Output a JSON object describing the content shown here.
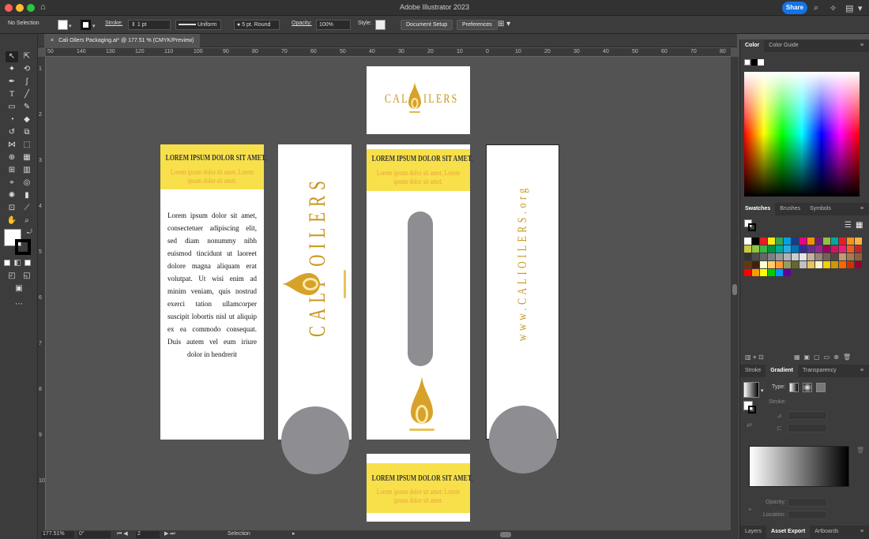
{
  "app": {
    "title": "Adobe Illustrator 2023",
    "share_label": "Share"
  },
  "control_bar": {
    "selection": "No Selection",
    "stroke_label": "Stroke:",
    "stroke_value": "1 pt",
    "profile": "Uniform",
    "brush": "5 pt. Round",
    "opacity_label": "Opacity:",
    "opacity_value": "100%",
    "style_label": "Style:",
    "document_setup": "Document Setup",
    "preferences": "Preferences"
  },
  "document": {
    "tab_title": "Cali Oilers Packaging.ai* @ 177.51 % (CMYK/Preview)"
  },
  "ruler_h": [
    "50",
    "140",
    "130",
    "120",
    "110",
    "100",
    "90",
    "80",
    "70",
    "60",
    "50",
    "40",
    "30",
    "20",
    "10",
    "0",
    "10",
    "20",
    "30",
    "40",
    "50",
    "60",
    "70",
    "80"
  ],
  "ruler_v": [
    "1",
    "2",
    "3",
    "4",
    "5",
    "6",
    "7",
    "8",
    "9",
    "10"
  ],
  "artwork": {
    "brand": "CALI OILERS",
    "brand_left": "CALI",
    "brand_right": "ILERS",
    "headline": "LOREM IPSUM DOLOR SIT AMET,",
    "subline": "Lorem ipsum dolor sit amet, Lorem ipsum dolor sit amet.",
    "body": "Lorem ipsum dolor sit amet, consectetuer adipiscing elit, sed diam nonummy nibh euismod tincidunt ut laoreet dolore magna aliquam erat volutpat. Ut wisi enim ad minim veniam, quis nostrud exerci tation ullamcorper suscipit lobortis nisl ut aliquip ex ea commodo consequat. Duis autem vel eum iriure dolor in hendrerit",
    "website": "www.CALIOILERS.org"
  },
  "status": {
    "zoom": "177.51%",
    "rotation": "0°",
    "artboard": "2",
    "tool": "Selection"
  },
  "panels": {
    "color_tabs": [
      "Color",
      "Color Guide"
    ],
    "swatch_tabs": [
      "Swatches",
      "Brushes",
      "Symbols"
    ],
    "gradient_tabs": [
      "Stroke",
      "Gradient",
      "Transparency"
    ],
    "gradient_type_label": "Type:",
    "gradient_stroke_label": "Stroke:",
    "gradient_opacity_label": "Opacity:",
    "gradient_location_label": "Location:",
    "bottom_tabs": [
      "Layers",
      "Asset Export",
      "Artboards"
    ]
  },
  "colors": {
    "accent_yellow": "#f8e04a",
    "brand_gold": "#c9961c",
    "sub_orange": "#e8a33a",
    "grey_shape": "#8e8e92"
  }
}
